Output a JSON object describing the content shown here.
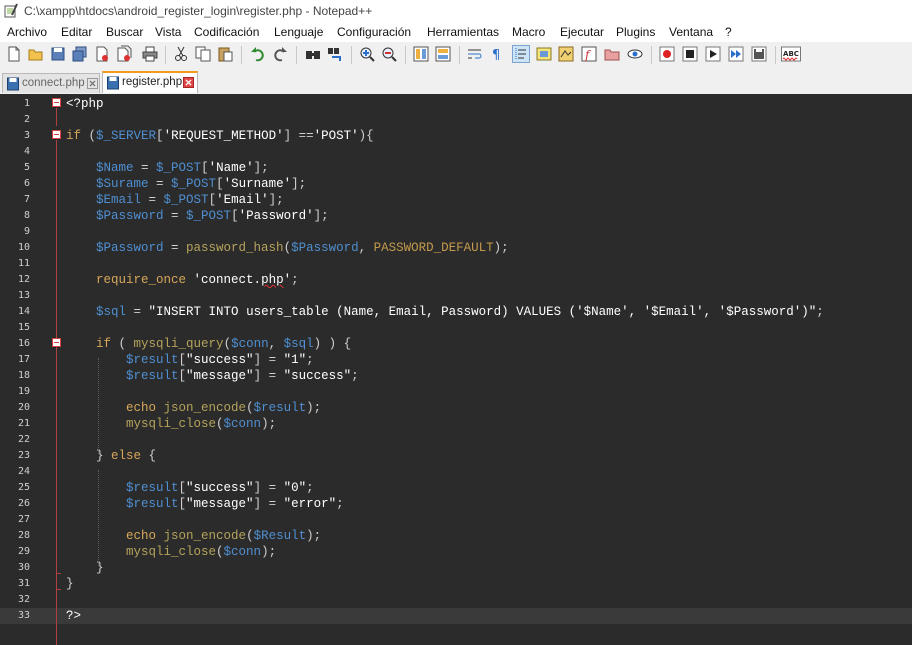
{
  "window": {
    "title": "C:\\xampp\\htdocs\\android_register_login\\register.php - Notepad++"
  },
  "menu": [
    "Archivo",
    "Editar",
    "Buscar",
    "Vista",
    "Codificación",
    "Lenguaje",
    "Configuración",
    "Herramientas",
    "Macro",
    "Ejecutar",
    "Plugins",
    "Ventana",
    "?"
  ],
  "toolbar": {
    "buttons": [
      "new-file",
      "open-file",
      "save",
      "save-all",
      "close",
      "close-all",
      "print",
      "cut",
      "copy",
      "paste",
      "undo",
      "redo",
      "find",
      "replace",
      "zoom-in",
      "zoom-out",
      "sync-vertical",
      "sync-horizontal",
      "word-wrap",
      "show-all-chars",
      "indent-guide",
      "user-language",
      "doc-map",
      "function-list",
      "folder-as-workspace",
      "monitor",
      "record-macro",
      "stop-macro",
      "play-macro",
      "run-macro-multiple",
      "save-macro",
      "spell-check"
    ],
    "spell_label": "ABC"
  },
  "tabs": [
    {
      "label": "connect.php",
      "active": false
    },
    {
      "label": "register.php",
      "active": true
    }
  ],
  "editor": {
    "current_line": 33,
    "lines": [
      {
        "n": "1",
        "segs": [
          {
            "c": "t-tag",
            "t": "<?php"
          }
        ]
      },
      {
        "n": "2",
        "segs": []
      },
      {
        "n": "3",
        "segs": [
          {
            "c": "t-kw",
            "t": "if"
          },
          {
            "c": "t-op",
            "t": " ("
          },
          {
            "c": "t-var",
            "t": "$_SERVER"
          },
          {
            "c": "t-op",
            "t": "["
          },
          {
            "c": "t-str",
            "t": "'REQUEST_METHOD'"
          },
          {
            "c": "t-op",
            "t": "] =="
          },
          {
            "c": "t-str",
            "t": "'POST'"
          },
          {
            "c": "t-op",
            "t": "){"
          }
        ]
      },
      {
        "n": "4",
        "segs": []
      },
      {
        "n": "5",
        "segs": [
          {
            "c": "t-op",
            "t": "    "
          },
          {
            "c": "t-var",
            "t": "$Name"
          },
          {
            "c": "t-op",
            "t": " = "
          },
          {
            "c": "t-var",
            "t": "$_POST"
          },
          {
            "c": "t-op",
            "t": "["
          },
          {
            "c": "t-str",
            "t": "'Name'"
          },
          {
            "c": "t-op",
            "t": "];"
          }
        ]
      },
      {
        "n": "6",
        "segs": [
          {
            "c": "t-op",
            "t": "    "
          },
          {
            "c": "t-var",
            "t": "$Surame"
          },
          {
            "c": "t-op",
            "t": " = "
          },
          {
            "c": "t-var",
            "t": "$_POST"
          },
          {
            "c": "t-op",
            "t": "["
          },
          {
            "c": "t-str",
            "t": "'Surname'"
          },
          {
            "c": "t-op",
            "t": "];"
          }
        ]
      },
      {
        "n": "7",
        "segs": [
          {
            "c": "t-op",
            "t": "    "
          },
          {
            "c": "t-var",
            "t": "$Email"
          },
          {
            "c": "t-op",
            "t": " = "
          },
          {
            "c": "t-var",
            "t": "$_POST"
          },
          {
            "c": "t-op",
            "t": "["
          },
          {
            "c": "t-str",
            "t": "'Email'"
          },
          {
            "c": "t-op",
            "t": "];"
          }
        ]
      },
      {
        "n": "8",
        "segs": [
          {
            "c": "t-op",
            "t": "    "
          },
          {
            "c": "t-var",
            "t": "$Password"
          },
          {
            "c": "t-op",
            "t": " = "
          },
          {
            "c": "t-var",
            "t": "$_POST"
          },
          {
            "c": "t-op",
            "t": "["
          },
          {
            "c": "t-str",
            "t": "'Password'"
          },
          {
            "c": "t-op",
            "t": "];"
          }
        ]
      },
      {
        "n": "9",
        "segs": []
      },
      {
        "n": "10",
        "segs": [
          {
            "c": "t-op",
            "t": "    "
          },
          {
            "c": "t-var",
            "t": "$Password"
          },
          {
            "c": "t-op",
            "t": " = "
          },
          {
            "c": "t-fn",
            "t": "password_hash"
          },
          {
            "c": "t-op",
            "t": "("
          },
          {
            "c": "t-var",
            "t": "$Password"
          },
          {
            "c": "t-op",
            "t": ", "
          },
          {
            "c": "t-const",
            "t": "PASSWORD_DEFAULT"
          },
          {
            "c": "t-op",
            "t": ");"
          }
        ]
      },
      {
        "n": "11",
        "segs": []
      },
      {
        "n": "12",
        "segs": [
          {
            "c": "t-op",
            "t": "    "
          },
          {
            "c": "t-kw",
            "t": "require_once"
          },
          {
            "c": "t-op",
            "t": " "
          },
          {
            "c": "t-str",
            "t": "'connect."
          },
          {
            "c": "t-str t-err",
            "t": "php"
          },
          {
            "c": "t-str",
            "t": "'"
          },
          {
            "c": "t-op",
            "t": ";"
          }
        ]
      },
      {
        "n": "13",
        "segs": []
      },
      {
        "n": "14",
        "segs": [
          {
            "c": "t-op",
            "t": "    "
          },
          {
            "c": "t-var",
            "t": "$sql"
          },
          {
            "c": "t-op",
            "t": " = "
          },
          {
            "c": "t-str",
            "t": "\"INSERT INTO users_table (Name, Email, Password) VALUES ('"
          },
          {
            "c": "t-str",
            "t": "$Name"
          },
          {
            "c": "t-str",
            "t": "', '"
          },
          {
            "c": "t-str",
            "t": "$Email"
          },
          {
            "c": "t-str",
            "t": "', '"
          },
          {
            "c": "t-str",
            "t": "$Password"
          },
          {
            "c": "t-str",
            "t": "')\""
          },
          {
            "c": "t-op",
            "t": ";"
          }
        ]
      },
      {
        "n": "15",
        "segs": []
      },
      {
        "n": "16",
        "segs": [
          {
            "c": "t-op",
            "t": "    "
          },
          {
            "c": "t-kw",
            "t": "if"
          },
          {
            "c": "t-op",
            "t": " ( "
          },
          {
            "c": "t-fn",
            "t": "mysqli_query"
          },
          {
            "c": "t-op",
            "t": "("
          },
          {
            "c": "t-var",
            "t": "$conn"
          },
          {
            "c": "t-op",
            "t": ", "
          },
          {
            "c": "t-var",
            "t": "$sql"
          },
          {
            "c": "t-op",
            "t": ") ) {"
          }
        ]
      },
      {
        "n": "17",
        "segs": [
          {
            "c": "t-op",
            "t": "        "
          },
          {
            "c": "t-var",
            "t": "$result"
          },
          {
            "c": "t-op",
            "t": "["
          },
          {
            "c": "t-str",
            "t": "\"success\""
          },
          {
            "c": "t-op",
            "t": "] = "
          },
          {
            "c": "t-str",
            "t": "\"1\""
          },
          {
            "c": "t-op",
            "t": ";"
          }
        ]
      },
      {
        "n": "18",
        "segs": [
          {
            "c": "t-op",
            "t": "        "
          },
          {
            "c": "t-var",
            "t": "$result"
          },
          {
            "c": "t-op",
            "t": "["
          },
          {
            "c": "t-str",
            "t": "\"message\""
          },
          {
            "c": "t-op",
            "t": "] = "
          },
          {
            "c": "t-str",
            "t": "\"success\""
          },
          {
            "c": "t-op",
            "t": ";"
          }
        ]
      },
      {
        "n": "19",
        "segs": []
      },
      {
        "n": "20",
        "segs": [
          {
            "c": "t-op",
            "t": "        "
          },
          {
            "c": "t-kw",
            "t": "echo"
          },
          {
            "c": "t-op",
            "t": " "
          },
          {
            "c": "t-fn",
            "t": "json_encode"
          },
          {
            "c": "t-op",
            "t": "("
          },
          {
            "c": "t-var",
            "t": "$result"
          },
          {
            "c": "t-op",
            "t": ");"
          }
        ]
      },
      {
        "n": "21",
        "segs": [
          {
            "c": "t-op",
            "t": "        "
          },
          {
            "c": "t-fn",
            "t": "mysqli_close"
          },
          {
            "c": "t-op",
            "t": "("
          },
          {
            "c": "t-var",
            "t": "$conn"
          },
          {
            "c": "t-op",
            "t": ");"
          }
        ]
      },
      {
        "n": "22",
        "segs": []
      },
      {
        "n": "23",
        "segs": [
          {
            "c": "t-op",
            "t": "    } "
          },
          {
            "c": "t-kw",
            "t": "else"
          },
          {
            "c": "t-op",
            "t": " {"
          }
        ]
      },
      {
        "n": "24",
        "segs": []
      },
      {
        "n": "25",
        "segs": [
          {
            "c": "t-op",
            "t": "        "
          },
          {
            "c": "t-var",
            "t": "$result"
          },
          {
            "c": "t-op",
            "t": "["
          },
          {
            "c": "t-str",
            "t": "\"success\""
          },
          {
            "c": "t-op",
            "t": "] = "
          },
          {
            "c": "t-str",
            "t": "\"0\""
          },
          {
            "c": "t-op",
            "t": ";"
          }
        ]
      },
      {
        "n": "26",
        "segs": [
          {
            "c": "t-op",
            "t": "        "
          },
          {
            "c": "t-var",
            "t": "$result"
          },
          {
            "c": "t-op",
            "t": "["
          },
          {
            "c": "t-str",
            "t": "\"message\""
          },
          {
            "c": "t-op",
            "t": "] = "
          },
          {
            "c": "t-str",
            "t": "\"error\""
          },
          {
            "c": "t-op",
            "t": ";"
          }
        ]
      },
      {
        "n": "27",
        "segs": []
      },
      {
        "n": "28",
        "segs": [
          {
            "c": "t-op",
            "t": "        "
          },
          {
            "c": "t-kw",
            "t": "echo"
          },
          {
            "c": "t-op",
            "t": " "
          },
          {
            "c": "t-fn",
            "t": "json_encode"
          },
          {
            "c": "t-op",
            "t": "("
          },
          {
            "c": "t-var",
            "t": "$Result"
          },
          {
            "c": "t-op",
            "t": ");"
          }
        ]
      },
      {
        "n": "29",
        "segs": [
          {
            "c": "t-op",
            "t": "        "
          },
          {
            "c": "t-fn",
            "t": "mysqli_close"
          },
          {
            "c": "t-op",
            "t": "("
          },
          {
            "c": "t-var",
            "t": "$conn"
          },
          {
            "c": "t-op",
            "t": ");"
          }
        ]
      },
      {
        "n": "30",
        "segs": [
          {
            "c": "t-op",
            "t": "    }"
          }
        ]
      },
      {
        "n": "31",
        "segs": [
          {
            "c": "t-op",
            "t": "}"
          }
        ]
      },
      {
        "n": "32",
        "segs": []
      },
      {
        "n": "33",
        "segs": [
          {
            "c": "t-tag",
            "t": "?>"
          }
        ]
      }
    ]
  },
  "colors": {
    "editor_bg": "#2b2b2b",
    "keyword": "#d6a75a",
    "variable": "#4f8fd1",
    "string": "#ffffff",
    "fold_marker": "#d24040",
    "active_tab_accent": "#f29b1d"
  }
}
